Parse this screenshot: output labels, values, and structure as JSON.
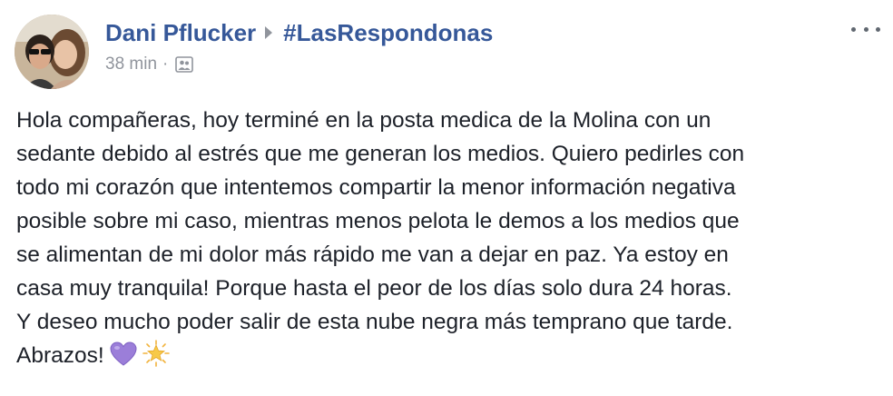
{
  "post": {
    "author": "Dani Pflucker",
    "group": "#LasRespondonas",
    "timestamp": "38 min",
    "separator": "·",
    "audience_icon": "friends-icon",
    "more_icon": "more-options-icon",
    "lines": [
      "Hola compañeras, hoy terminé en la posta medica de la Molina con un",
      "sedante debido al estrés que me generan los medios. Quiero pedirles con",
      "todo mi corazón que intentemos compartir la menor información negativa",
      "posible sobre mi caso, mientras menos pelota le demos a los medios que",
      "se alimentan de mi dolor más rápido me van a dejar en paz. Ya estoy en",
      "casa muy tranquila! Porque hasta el peor de los días solo dura 24 horas.",
      "Y deseo mucho poder salir de esta nube negra más temprano que tarde.",
      "Abrazos!"
    ],
    "emojis": [
      "purple-heart-icon",
      "glowing-star-icon"
    ]
  },
  "colors": {
    "link": "#365899",
    "meta": "#90949c",
    "text": "#1d2129",
    "heart": "#9b7ed9",
    "star": "#f7c948"
  }
}
